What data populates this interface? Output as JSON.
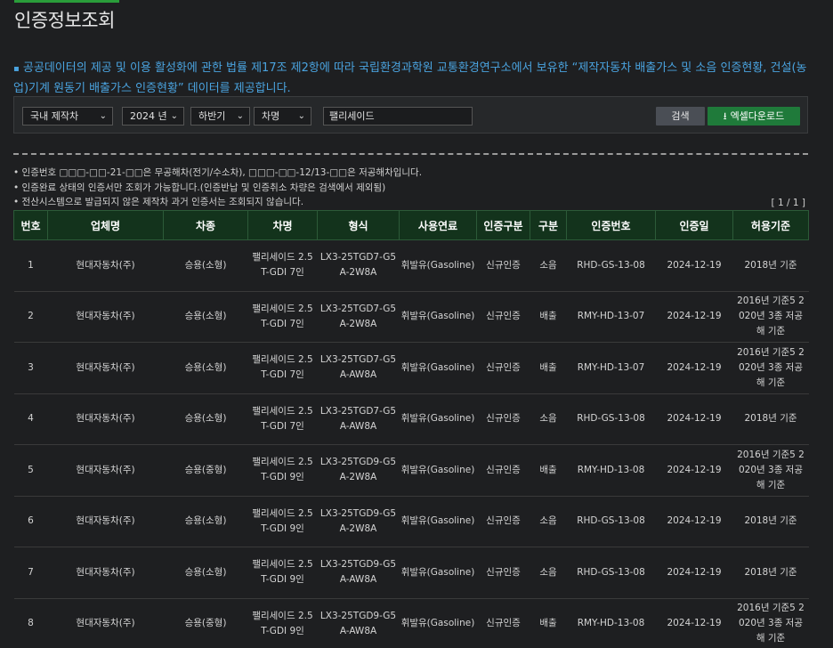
{
  "page": {
    "title": "인증정보조회"
  },
  "intro": "공공데이터의 제공 및 이용 활성화에 관한 법률 제17조 제2항에 따라 국립환경과학원 교통환경연구소에서 보유한 “제작자동차 배출가스 및 소음 인증현황, 건설(농업)기계 원동기 배출가스 인증현황” 데이터를 제공합니다.",
  "filter": {
    "category": "국내 제작차",
    "year": "2024 년",
    "half": "하반기",
    "field": "차명",
    "query": "팰리세이드",
    "search_label": "검색",
    "excel_label": "엑셀다운로드"
  },
  "notes": [
    "인증번호 □□□-□□-21-□□은 무공해차(전기/수소차), □□□-□□-12/13-□□은 저공해차입니다.",
    "인증완료 상태의 인증서만 조회가 가능합니다.(인증반납 및 인증취소 차량은 검색에서 제외됨)",
    "전산시스템으로 발급되지 않은 제작차 과거 인증서는 조회되지 않습니다."
  ],
  "pager": "[ 1 / 1 ]",
  "table": {
    "headers": [
      "번호",
      "업체명",
      "차종",
      "차명",
      "형식",
      "사용연료",
      "인증구분",
      "구분",
      "인증번호",
      "인증일",
      "허용기준"
    ],
    "rows": [
      [
        "1",
        "현대자동차(주)",
        "승용(소형)",
        "팰리세이드 2.5T-GDI 7인",
        "LX3-25TGD7-G5A-2W8A",
        "휘발유(Gasoline)",
        "신규인증",
        "소음",
        "RHD-GS-13-08",
        "2024-12-19",
        "2018년 기준"
      ],
      [
        "2",
        "현대자동차(주)",
        "승용(소형)",
        "팰리세이드 2.5T-GDI 7인",
        "LX3-25TGD7-G5A-2W8A",
        "휘발유(Gasoline)",
        "신규인증",
        "배출",
        "RMY-HD-13-07",
        "2024-12-19",
        "2016년 기준5 2020년 3종 저공해 기준"
      ],
      [
        "3",
        "현대자동차(주)",
        "승용(소형)",
        "팰리세이드 2.5T-GDI 7인",
        "LX3-25TGD7-G5A-AW8A",
        "휘발유(Gasoline)",
        "신규인증",
        "배출",
        "RMY-HD-13-07",
        "2024-12-19",
        "2016년 기준5 2020년 3종 저공해 기준"
      ],
      [
        "4",
        "현대자동차(주)",
        "승용(소형)",
        "팰리세이드 2.5T-GDI 7인",
        "LX3-25TGD7-G5A-AW8A",
        "휘발유(Gasoline)",
        "신규인증",
        "소음",
        "RHD-GS-13-08",
        "2024-12-19",
        "2018년 기준"
      ],
      [
        "5",
        "현대자동차(주)",
        "승용(중형)",
        "팰리세이드 2.5T-GDI 9인",
        "LX3-25TGD9-G5A-2W8A",
        "휘발유(Gasoline)",
        "신규인증",
        "배출",
        "RMY-HD-13-08",
        "2024-12-19",
        "2016년 기준5 2020년 3종 저공해 기준"
      ],
      [
        "6",
        "현대자동차(주)",
        "승용(소형)",
        "팰리세이드 2.5T-GDI 9인",
        "LX3-25TGD9-G5A-2W8A",
        "휘발유(Gasoline)",
        "신규인증",
        "소음",
        "RHD-GS-13-08",
        "2024-12-19",
        "2018년 기준"
      ],
      [
        "7",
        "현대자동차(주)",
        "승용(소형)",
        "팰리세이드 2.5T-GDI 9인",
        "LX3-25TGD9-G5A-AW8A",
        "휘발유(Gasoline)",
        "신규인증",
        "소음",
        "RHD-GS-13-08",
        "2024-12-19",
        "2018년 기준"
      ],
      [
        "8",
        "현대자동차(주)",
        "승용(중형)",
        "팰리세이드 2.5T-GDI 9인",
        "LX3-25TGD9-G5A-AW8A",
        "휘발유(Gasoline)",
        "신규인증",
        "배출",
        "RMY-HD-13-08",
        "2024-12-19",
        "2016년 기준5 2020년 3종 저공해 기준"
      ]
    ]
  }
}
